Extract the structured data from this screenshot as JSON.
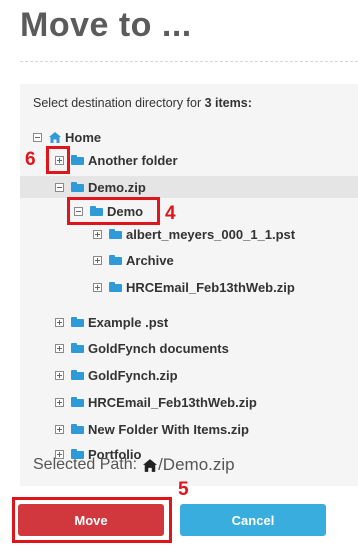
{
  "page": {
    "title": "Move to ..."
  },
  "panel": {
    "instruction_prefix": "Select destination directory for ",
    "instruction_count": "3 items:"
  },
  "tree": {
    "home": "Home",
    "items": [
      {
        "label": "Another folder"
      },
      {
        "label": "Demo.zip"
      },
      {
        "label": "Demo"
      },
      {
        "label": "albert_meyers_000_1_1.pst"
      },
      {
        "label": "Archive"
      },
      {
        "label": "HRCEmail_Feb13thWeb.zip"
      },
      {
        "label": "Example .pst"
      },
      {
        "label": "GoldFynch documents"
      },
      {
        "label": "GoldFynch.zip"
      },
      {
        "label": "HRCEmail_Feb13thWeb.zip"
      },
      {
        "label": "New Folder With Items.zip"
      },
      {
        "label": "Portfolio"
      }
    ]
  },
  "selected_path": {
    "label": "Selected Path:",
    "value": "/Demo.zip"
  },
  "buttons": {
    "move": "Move",
    "cancel": "Cancel"
  },
  "annotations": {
    "n4": "4",
    "n5": "5",
    "n6": "6"
  },
  "colors": {
    "accent_red": "#d0383e",
    "accent_blue": "#39aede",
    "folder": "#2f9ad8",
    "annotation": "#e0151c"
  },
  "icons": {
    "home": "home-icon",
    "folder": "folder-icon",
    "expand": "plus-square-icon",
    "collapse": "minus-square-icon"
  }
}
